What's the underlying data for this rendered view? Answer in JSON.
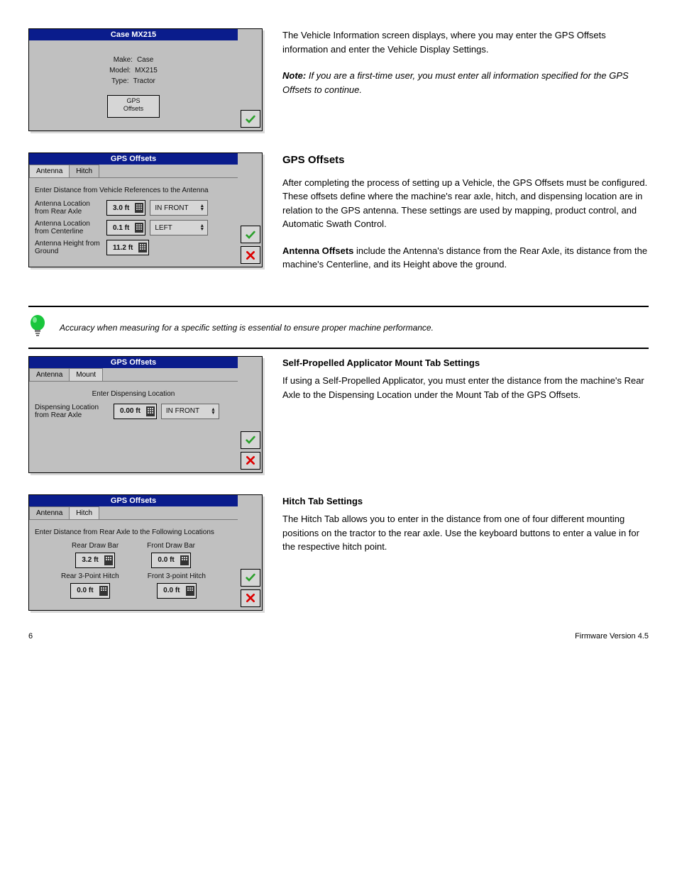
{
  "s1": {
    "title": "Case MX215",
    "make_lbl": "Make:",
    "make": "Case",
    "model_lbl": "Model:",
    "model": "MX215",
    "type_lbl": "Type:",
    "type": "Tractor",
    "gps_btn_l1": "GPS",
    "gps_btn_l2": "Offsets",
    "text": "The Vehicle Information screen displays, where you may enter the GPS Offsets information and enter the Vehicle Display Settings.",
    "note_b": "Note:",
    "note": "If you are a first-time user, you must enter all information specified for the GPS Offsets to continue."
  },
  "s2": {
    "title": "GPS Offsets",
    "tab1": "Antenna",
    "tab2": "Hitch",
    "instr": "Enter Distance from Vehicle References to the Antenna",
    "r1_lbl": "Antenna Location from Rear Axle",
    "r1_val": "3.0 ft",
    "r1_sel": "IN FRONT",
    "r2_lbl": "Antenna Location from Centerline",
    "r2_val": "0.1 ft",
    "r2_sel": "LEFT",
    "r3_lbl": "Antenna Height from Ground",
    "r3_val": "11.2 ft",
    "h": "GPS Offsets",
    "p1": "After completing the process of setting up a Vehicle, the GPS Offsets must be configured. These offsets define where the machine's rear axle, hitch, and dispensing location are in relation to the GPS antenna. These settings are used by mapping, product control, and Automatic Swath Control.",
    "p2_b": "Antenna Offsets",
    "p2_t": " include the Antenna's distance from the Rear Axle, its distance from the machine's Centerline, and its Height above the ground."
  },
  "tip": "Accuracy when measuring for a specific setting is essential to ensure proper machine performance.",
  "s3": {
    "title": "GPS Offsets",
    "tab1": "Antenna",
    "tab2": "Mount",
    "instr": "Enter Dispensing Location",
    "lbl": "Dispensing Location from Rear Axle",
    "val": "0.00 ft",
    "sel": "IN FRONT",
    "h": "Self-Propelled Applicator Mount Tab Settings",
    "p": "If using a Self-Propelled Applicator, you must enter the distance from the machine's Rear Axle to the Dispensing Location under the Mount Tab of the GPS Offsets."
  },
  "s4": {
    "title": "GPS Offsets",
    "tab1": "Antenna",
    "tab2": "Hitch",
    "instr": "Enter Distance from Rear Axle to the Following Locations",
    "c1_lbl": "Rear Draw Bar",
    "c1_val": "3.2 ft",
    "c2_lbl": "Front Draw Bar",
    "c2_val": "0.0 ft",
    "c3_lbl": "Rear 3-Point Hitch",
    "c3_val": "0.0 ft",
    "c4_lbl": "Front 3-point Hitch",
    "c4_val": "0.0 ft",
    "h": "Hitch Tab Settings",
    "p": "The Hitch Tab allows you to enter in the distance from one of four different mounting positions on the tractor to the rear axle. Use the keyboard buttons to enter a value in for the respective hitch point."
  },
  "footer_l": "6",
  "footer_r": "Firmware Version 4.5"
}
